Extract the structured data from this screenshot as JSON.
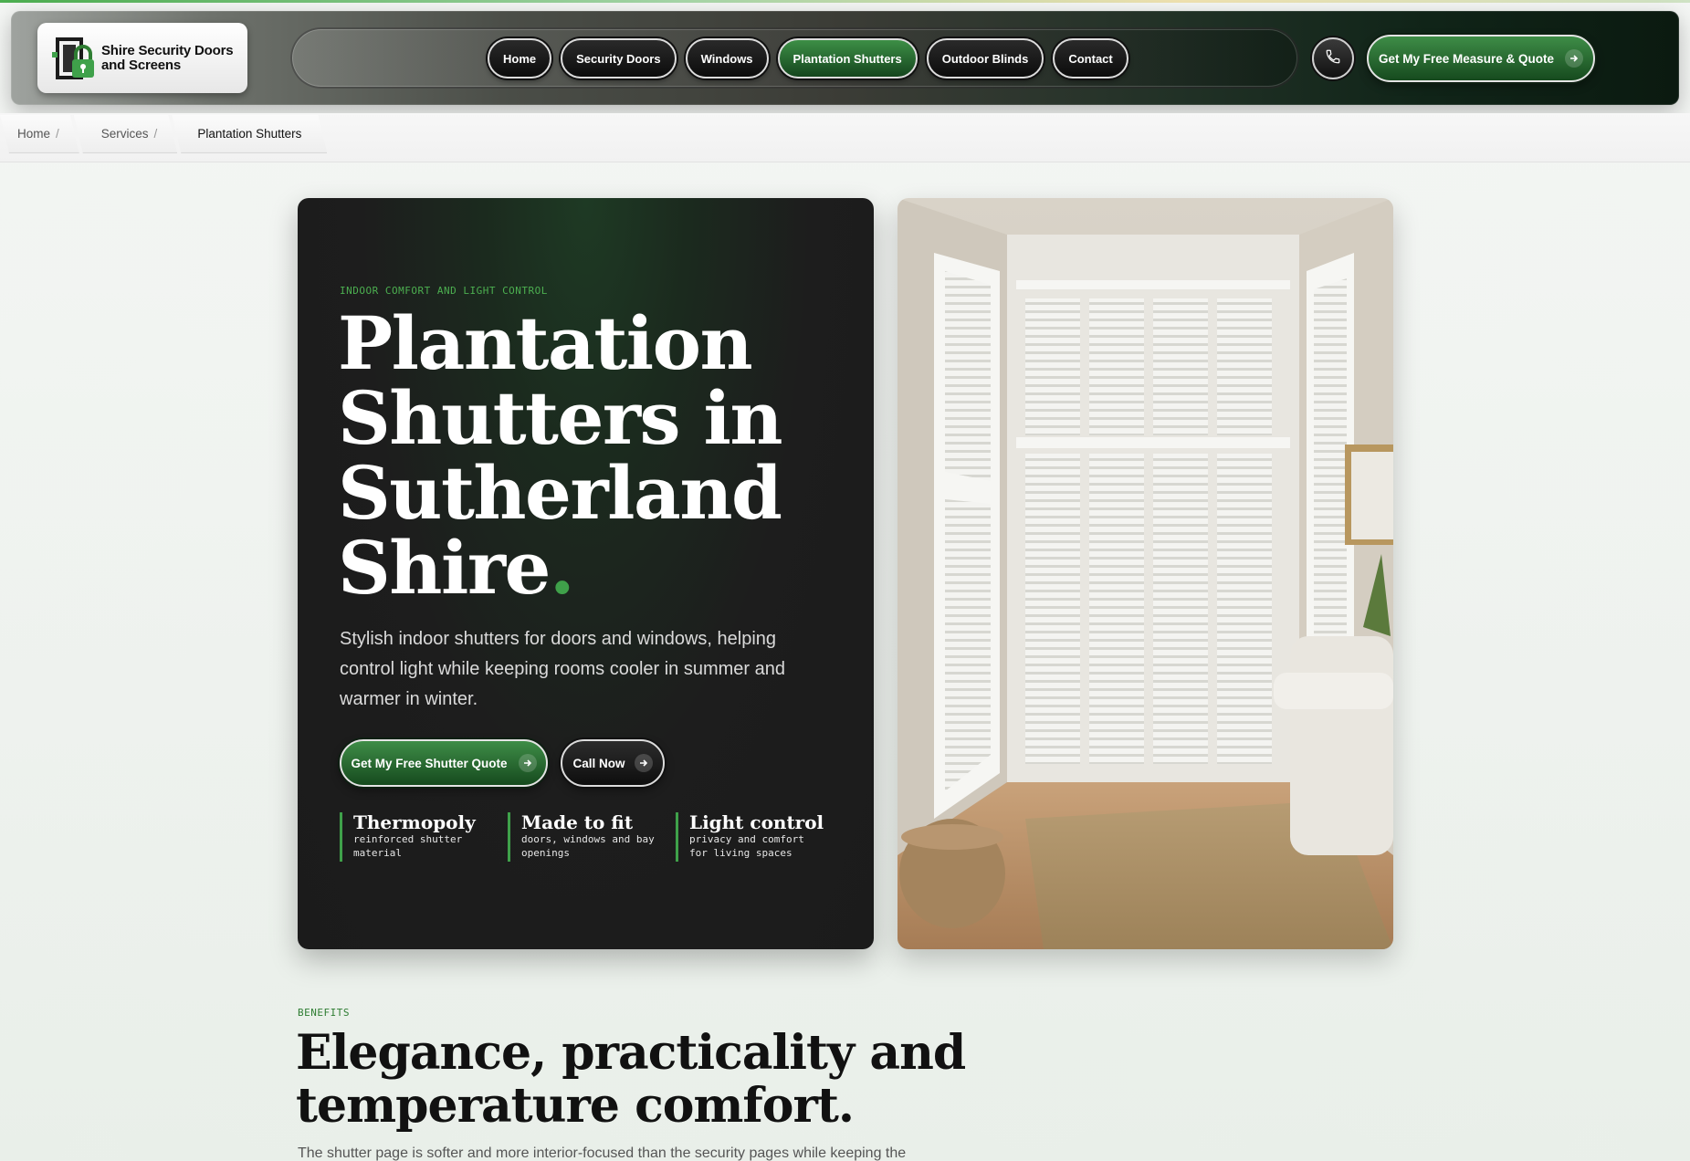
{
  "logo": {
    "line1": "Shire Security Doors",
    "line2": "and Screens"
  },
  "nav": {
    "items": [
      {
        "label": "Home"
      },
      {
        "label": "Security Doors"
      },
      {
        "label": "Windows"
      },
      {
        "label": "Plantation Shutters"
      },
      {
        "label": "Outdoor Blinds"
      },
      {
        "label": "Contact"
      }
    ],
    "active": "Plantation Shutters",
    "cta_label": "Get My Free Measure & Quote"
  },
  "breadcrumb": {
    "items": [
      {
        "label": "Home",
        "sep": "/"
      },
      {
        "label": "Services",
        "sep": "/"
      },
      {
        "label": "Plantation Shutters",
        "sep": ""
      }
    ]
  },
  "hero": {
    "eyebrow": "INDOOR COMFORT AND LIGHT CONTROL",
    "title": "Plantation Shutters in Sutherland Shire",
    "title_dot": ".",
    "subtitle": "Stylish indoor shutters for doors and windows, helping control light while keeping rooms cooler in summer and warmer in winter.",
    "primary_button": "Get My Free Shutter Quote",
    "secondary_button": "Call Now",
    "features": [
      {
        "title": "Thermopoly",
        "desc": "reinforced shutter material"
      },
      {
        "title": "Made to fit",
        "desc": "doors, windows and bay openings"
      },
      {
        "title": "Light control",
        "desc": "privacy and comfort for living spaces"
      }
    ]
  },
  "benefits": {
    "eyebrow": "BENEFITS",
    "title": "Elegance, practicality and temperature comfort.",
    "text": "The shutter page is softer and more interior-focused than the security pages while keeping the"
  },
  "colors": {
    "brand_green": "#3fa14a",
    "dark_card": "#1d1d1d"
  }
}
